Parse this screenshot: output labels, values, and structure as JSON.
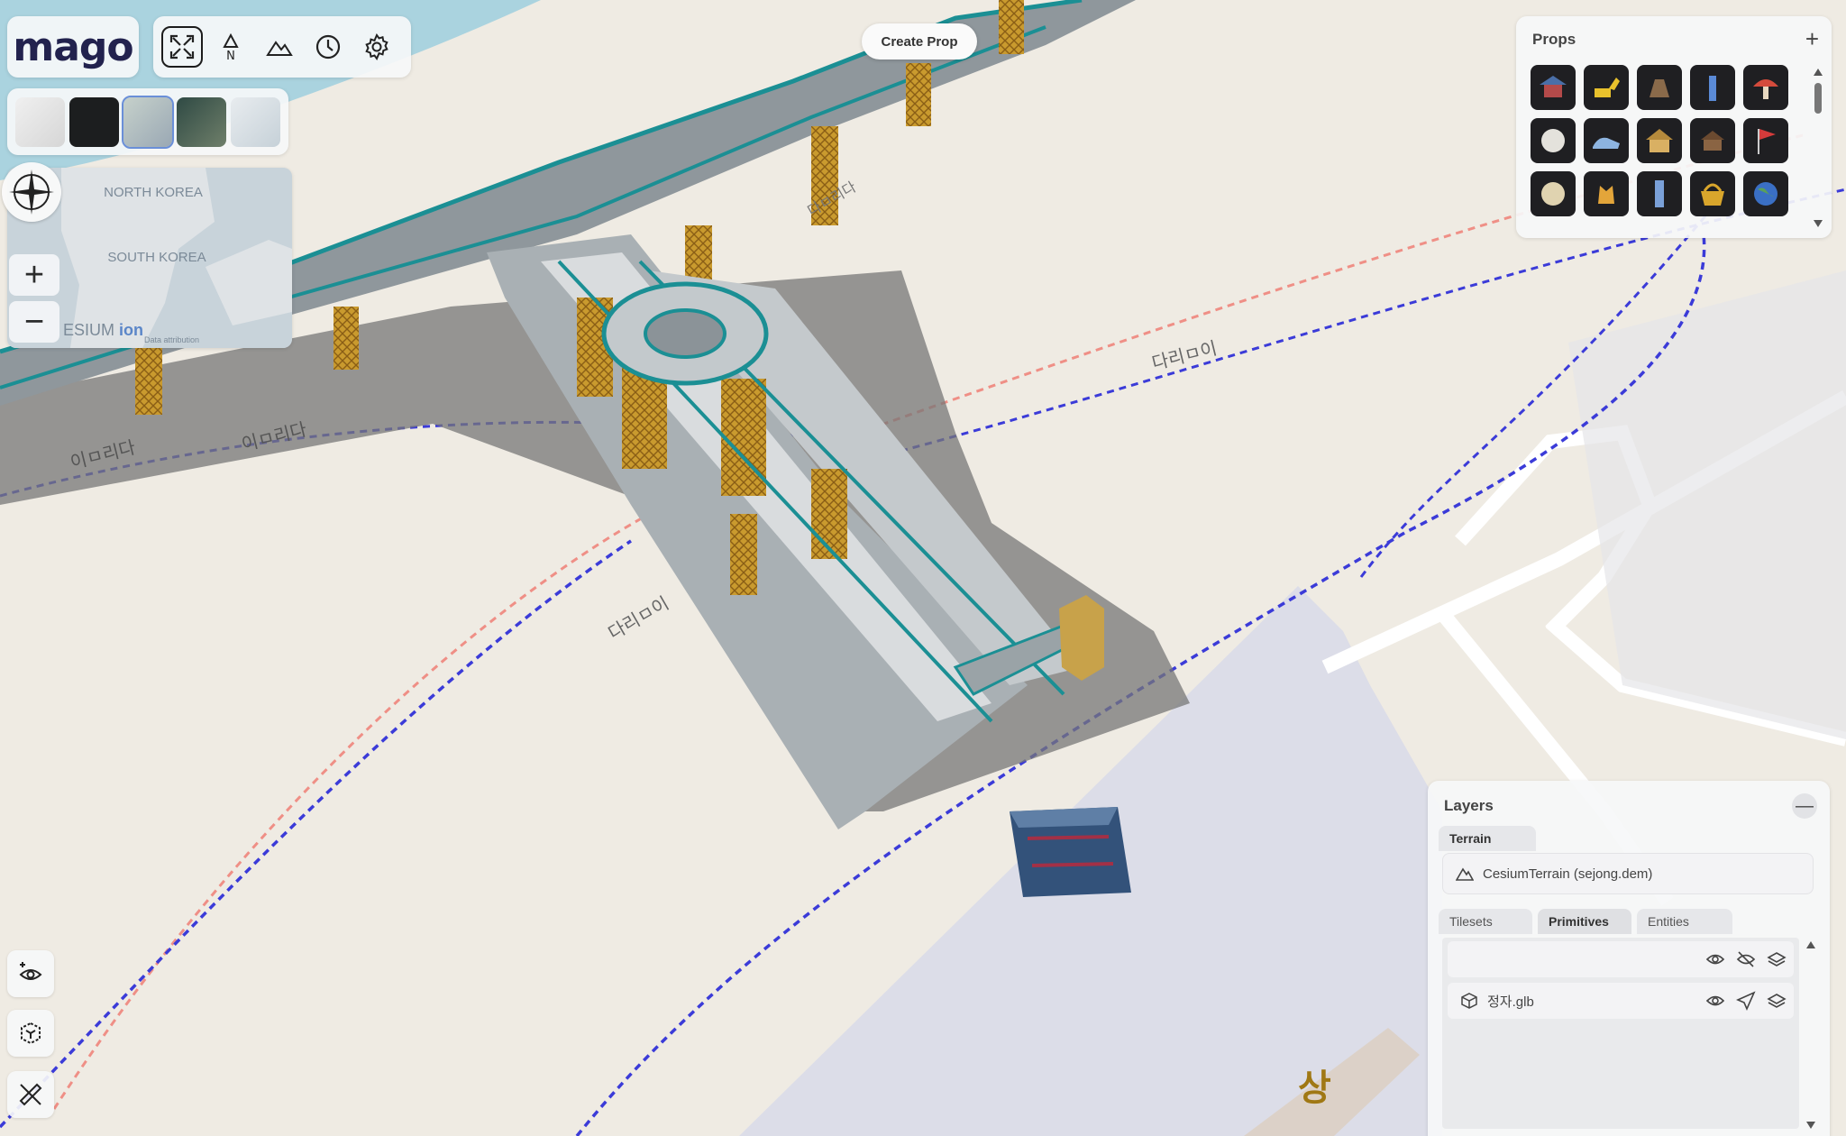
{
  "app": {
    "logo": "mago"
  },
  "toolbar": {
    "tools": [
      {
        "name": "fullscreen-icon",
        "active": true
      },
      {
        "name": "north-arrow-icon",
        "label": "N"
      },
      {
        "name": "terrain-icon"
      },
      {
        "name": "clock-icon"
      },
      {
        "name": "gear-icon"
      }
    ]
  },
  "basemaps": [
    {
      "name": "light-map",
      "selected": false
    },
    {
      "name": "dark-map",
      "selected": false
    },
    {
      "name": "street-map",
      "selected": true
    },
    {
      "name": "satellite-map",
      "selected": false
    },
    {
      "name": "light-street-map",
      "selected": false
    }
  ],
  "minimap": {
    "labels": [
      "NORTH KOREA",
      "SOUTH KOREA"
    ],
    "credit": "ESIUM",
    "credit_ion": "ion",
    "credit_small": "Data attribution"
  },
  "zoom": {
    "in": "+",
    "out": "−"
  },
  "create_prop": "Create Prop",
  "props": {
    "title": "Props",
    "add": "+",
    "items": [
      "pavilion-icon",
      "excavator-icon",
      "anchor-rock-icon",
      "tower-icon",
      "mushroom-icon",
      "moon-icon",
      "shoe-icon",
      "house-icon",
      "cabin-icon",
      "flag-icon",
      "planet-icon",
      "fox-icon",
      "pillar-icon",
      "basket-icon",
      "earth-icon"
    ]
  },
  "map_labels": [
    "이ㅁ리다",
    "이ㅁ리다",
    "다리ㅁ이",
    "다리ㅁ이",
    "다ㅁ리다",
    "상"
  ],
  "layers": {
    "title": "Layers",
    "minimize": "—",
    "terrain_tab": "Terrain",
    "terrain_item": "CesiumTerrain (sejong.dem)",
    "tabs": [
      "Tilesets",
      "Primitives",
      "Entities"
    ],
    "active_tab": "Primitives",
    "primitive_item": "정자.glb"
  },
  "bottom_tools": [
    "add-view-icon",
    "model-icon",
    "measure-tool-icon"
  ],
  "colors": {
    "accent": "#22224e",
    "water": "#aad3df",
    "land": "#efebe3",
    "building": "#dcdde8",
    "teal": "#1b8f94"
  }
}
